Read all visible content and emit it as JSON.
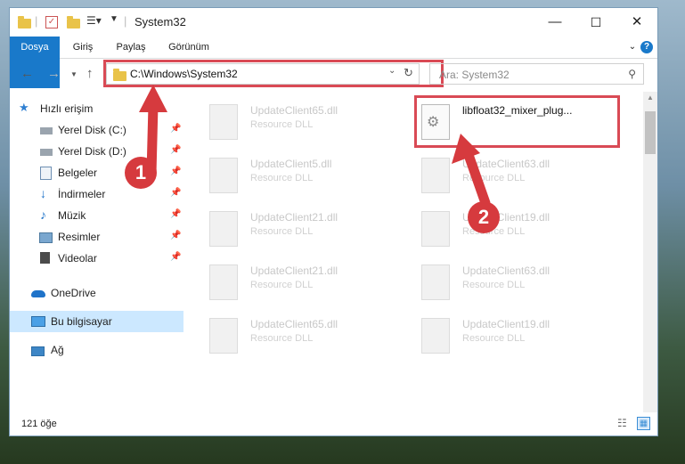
{
  "window": {
    "title": "System32"
  },
  "ribbon": {
    "tabs": [
      "Dosya",
      "Giriş",
      "Paylaş",
      "Görünüm"
    ]
  },
  "address": {
    "path": "C:\\Windows\\System32"
  },
  "search": {
    "placeholder": "Ara: System32"
  },
  "sidebar": {
    "quick_access": "Hızlı erişim",
    "items": [
      {
        "label": "Yerel Disk (C:)",
        "icon": "drive-icon",
        "pinned": true
      },
      {
        "label": "Yerel Disk (D:)",
        "icon": "drive-icon",
        "pinned": true
      },
      {
        "label": "Belgeler",
        "icon": "documents-icon",
        "pinned": true
      },
      {
        "label": "İndirmeler",
        "icon": "download-icon",
        "pinned": true
      },
      {
        "label": "Müzik",
        "icon": "music-icon",
        "pinned": true
      },
      {
        "label": "Resimler",
        "icon": "pictures-icon",
        "pinned": true
      },
      {
        "label": "Videolar",
        "icon": "videos-icon",
        "pinned": true
      }
    ],
    "onedrive": "OneDrive",
    "this_pc": "Bu bilgisayar",
    "network": "Ağ"
  },
  "files": [
    {
      "name": "UpdateClient65.dll",
      "type": "Resource DLL"
    },
    {
      "name": "libfloat32_mixer_plug...",
      "type": ""
    },
    {
      "name": "UpdateClient5.dll",
      "type": "Resource DLL"
    },
    {
      "name": "UpdateClient63.dll",
      "type": "Resource DLL"
    },
    {
      "name": "UpdateClient21.dll",
      "type": "Resource DLL"
    },
    {
      "name": "UpdateClient19.dll",
      "type": "Resource DLL"
    },
    {
      "name": "UpdateClient21.dll",
      "type": "Resource DLL"
    },
    {
      "name": "UpdateClient63.dll",
      "type": "Resource DLL"
    },
    {
      "name": "UpdateClient65.dll",
      "type": "Resource DLL"
    },
    {
      "name": "UpdateClient19.dll",
      "type": "Resource DLL"
    }
  ],
  "status": {
    "count": "121 öğe"
  },
  "annotations": {
    "step1": "1",
    "step2": "2"
  },
  "colors": {
    "accent": "#1979ca",
    "highlight": "#d94a55",
    "selection": "#cce8ff"
  }
}
